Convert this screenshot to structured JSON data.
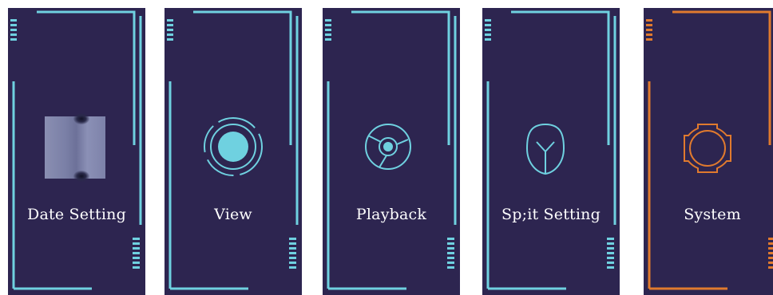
{
  "colors": {
    "background": "#ffffff",
    "card_background": "#2d2550",
    "accent_default": "#6fd1e0",
    "accent_selected": "#e07a2e",
    "label_text": "#ffffff"
  },
  "menu": {
    "items": [
      {
        "id": "date-setting",
        "label": "Date  Setting",
        "icon": "thumbnail-image",
        "selected": false
      },
      {
        "id": "view",
        "label": "View",
        "icon": "target-circle-icon",
        "selected": false
      },
      {
        "id": "playback",
        "label": "Playback",
        "icon": "aperture-icon",
        "selected": false
      },
      {
        "id": "split-setting",
        "label": "Sp;it  Setting",
        "icon": "split-shield-icon",
        "selected": false
      },
      {
        "id": "system",
        "label": "System",
        "icon": "gear-icon",
        "selected": true
      }
    ]
  }
}
